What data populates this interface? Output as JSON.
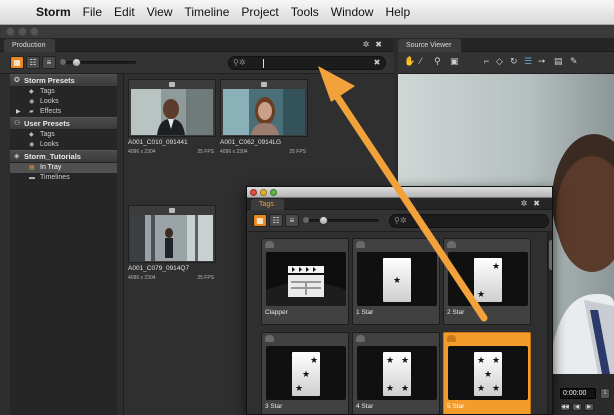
{
  "menubar": {
    "apple_icon": "apple-icon",
    "items": [
      "Storm",
      "File",
      "Edit",
      "View",
      "Timeline",
      "Project",
      "Tools",
      "Window",
      "Help"
    ]
  },
  "production": {
    "tab_label": "Production",
    "sidebar": {
      "storm_presets": {
        "label": "Storm Presets",
        "items": [
          "Tags",
          "Looks",
          "Effects"
        ]
      },
      "user_presets": {
        "label": "User Presets",
        "items": [
          "Tags",
          "Looks"
        ]
      },
      "storm_tutorials": {
        "label": "Storm_Tutorials",
        "items": [
          "In Tray",
          "Timelines"
        ]
      }
    },
    "clips": [
      {
        "name": "A001_C010_091441",
        "resolution": "4096 x 2304",
        "fps": "25 FPS"
      },
      {
        "name": "A001_C062_0914LG",
        "resolution": "4096 x 2304",
        "fps": "25 FPS"
      },
      {
        "name": "A001_C079_0914Q7",
        "resolution": "4096 x 2304",
        "fps": "25 FPS"
      }
    ]
  },
  "source_viewer": {
    "tab_label": "Source Viewer",
    "timecode": "0:00:00"
  },
  "tags_window": {
    "tab_label": "Tags",
    "tags": [
      {
        "label": "Clapper",
        "selected": false
      },
      {
        "label": "1 Star",
        "selected": false
      },
      {
        "label": "2 Star",
        "selected": false
      },
      {
        "label": "3 Star",
        "selected": false
      },
      {
        "label": "4 Star",
        "selected": false
      },
      {
        "label": "5 Star",
        "selected": true
      }
    ]
  },
  "colors": {
    "accent": "#f39c2b",
    "arrow": "#f2a23a",
    "panel_bg": "#2e2e2e"
  }
}
